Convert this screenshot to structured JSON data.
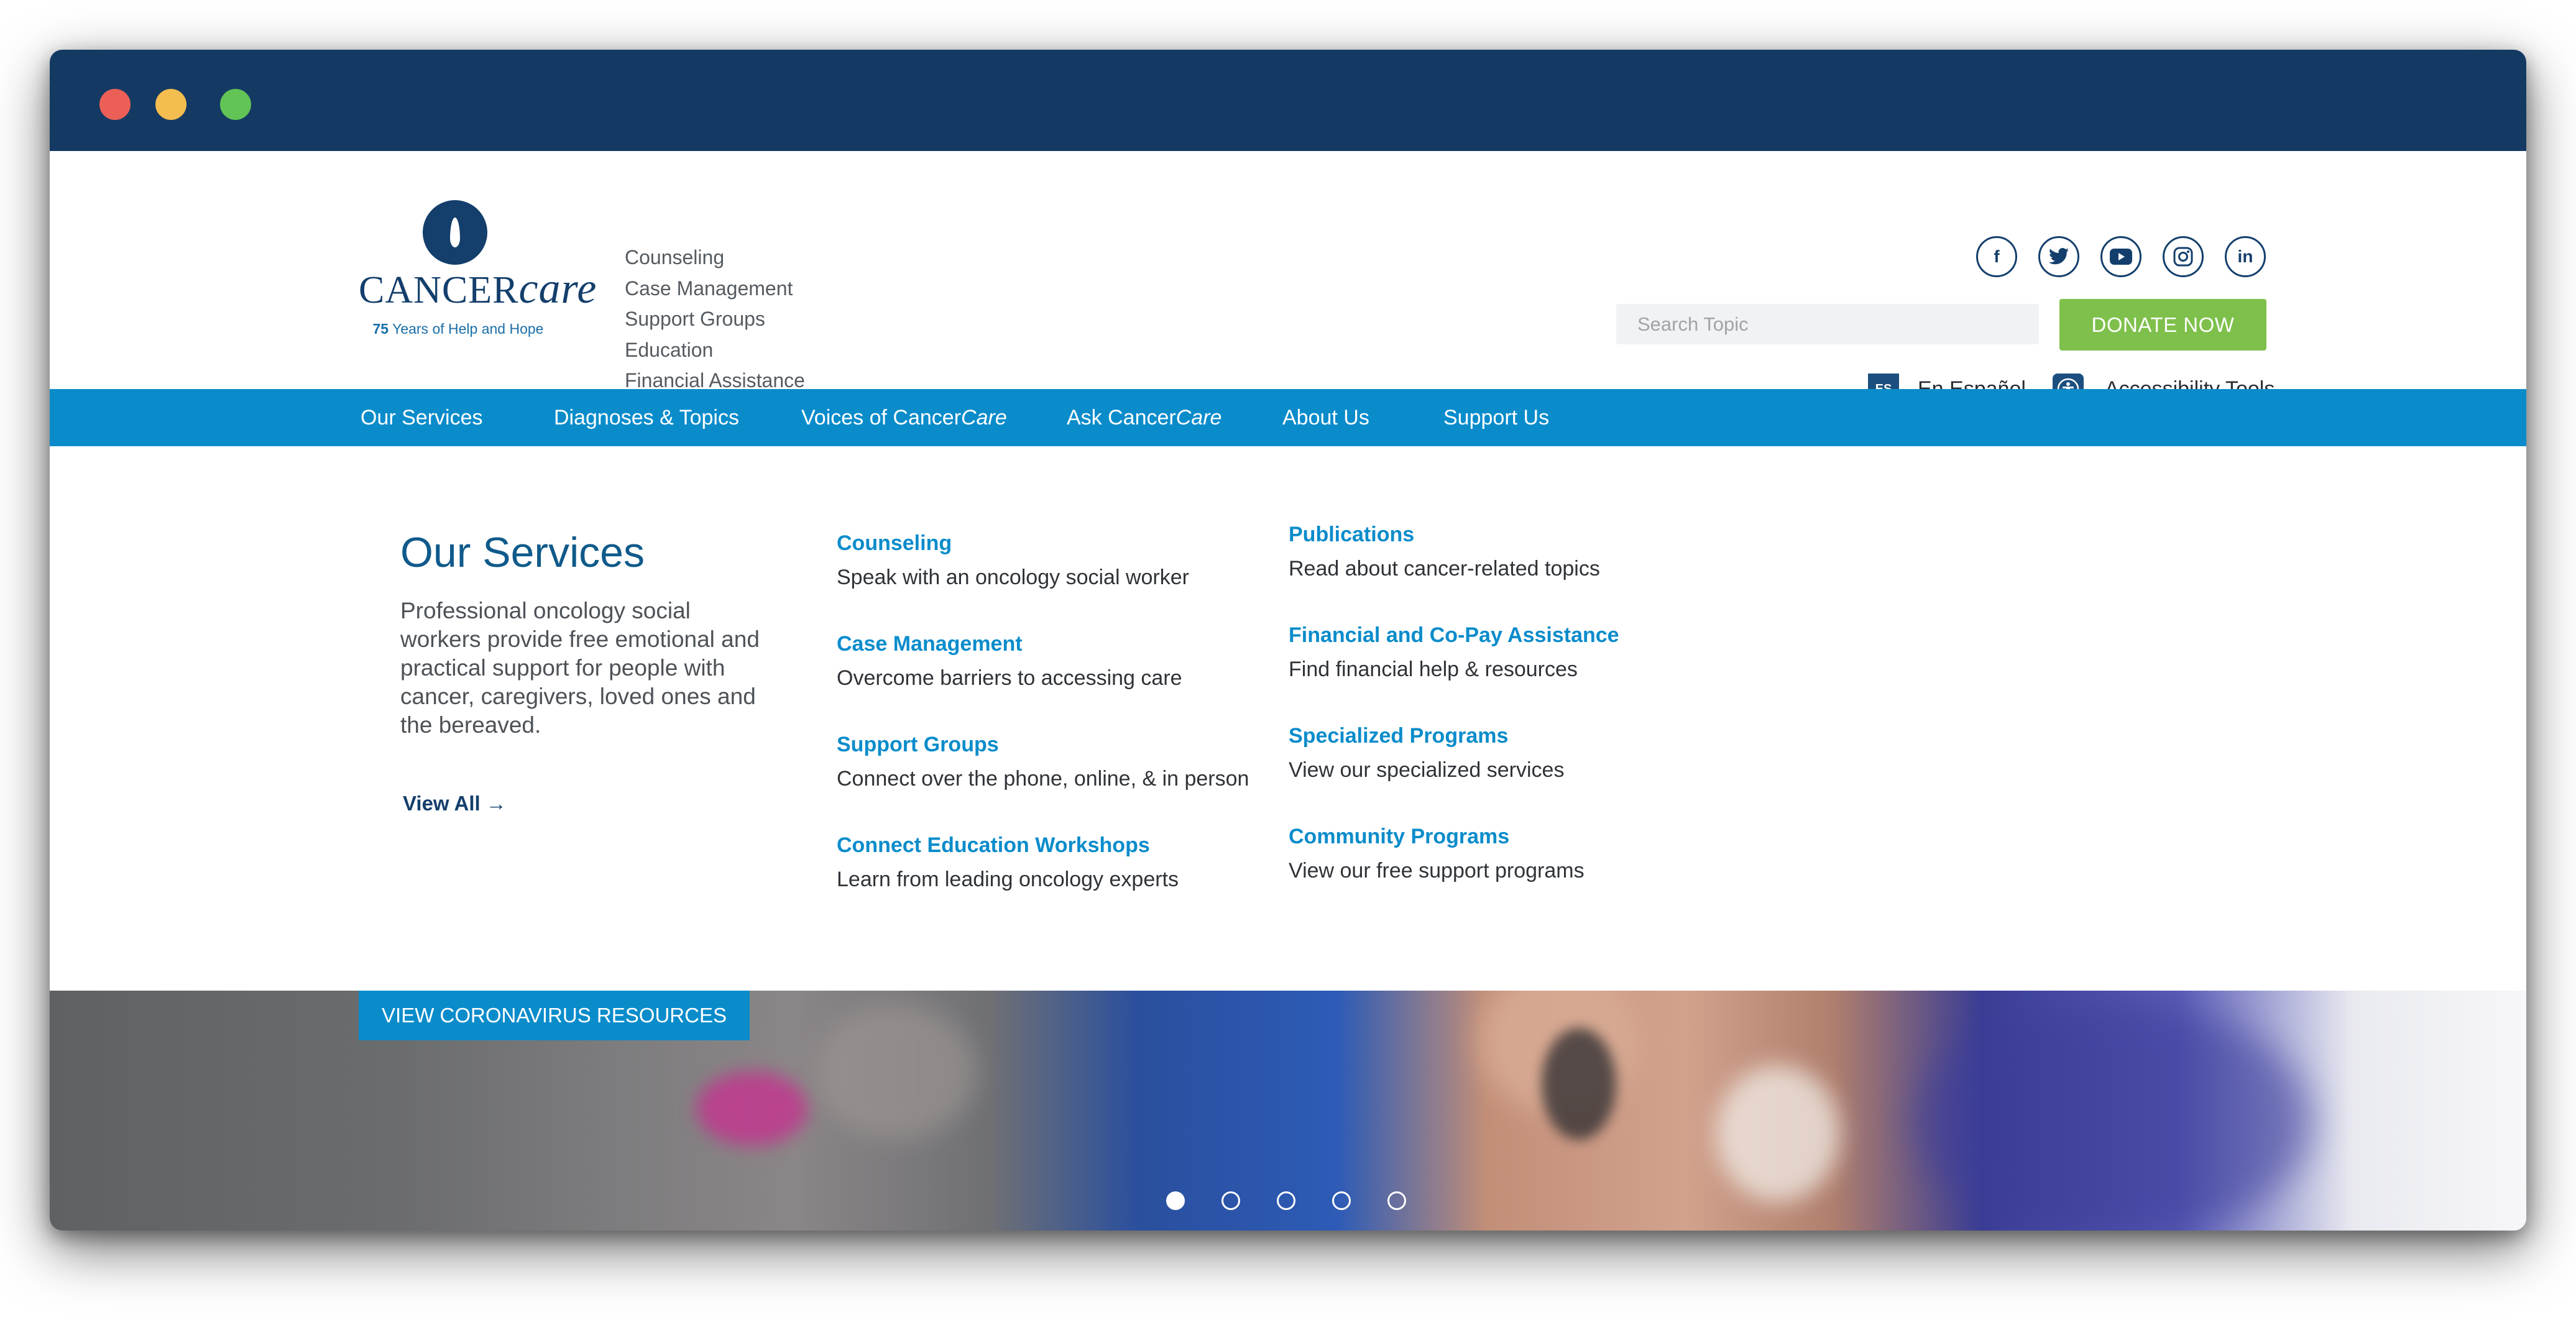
{
  "brand": {
    "name_part1": "CANCER",
    "name_part2": "care",
    "tagline_bold": "75",
    "tagline_rest": " Years of Help and Hope"
  },
  "quick_links": [
    "Counseling",
    "Case Management",
    "Support Groups",
    "Education",
    "Financial Assistance"
  ],
  "socials": [
    {
      "icon": "facebook-icon",
      "glyph": "f"
    },
    {
      "icon": "twitter-icon",
      "glyph": "t"
    },
    {
      "icon": "youtube-icon",
      "glyph": "▶"
    },
    {
      "icon": "instagram-icon",
      "glyph": "◎"
    },
    {
      "icon": "linkedin-icon",
      "glyph": "in"
    }
  ],
  "search": {
    "placeholder": "Search Topic"
  },
  "donate_label": "DONATE NOW",
  "language": {
    "badge": "ES",
    "label": "En Español"
  },
  "accessibility_label": "Accessibility Tools",
  "nav": {
    "our_services": "Our Services",
    "diagnoses": "Diagnoses & Topics",
    "voices_prefix": "Voices of Cancer",
    "voices_italic": "Care",
    "ask_prefix": "Ask Cancer",
    "ask_italic": "Care",
    "about": "About Us",
    "support": "Support Us"
  },
  "menu": {
    "title": "Our Services",
    "description": "Professional oncology social workers provide free emotional and practical support for people with cancer, caregivers, loved ones and the bereaved.",
    "view_all": "View All →",
    "left_column": [
      {
        "title": "Counseling",
        "desc": "Speak with an oncology social worker"
      },
      {
        "title": "Case Management",
        "desc": "Overcome barriers to accessing care"
      },
      {
        "title": "Support Groups",
        "desc": "Connect over the phone, online, & in person"
      },
      {
        "title": "Connect Education Workshops",
        "desc": "Learn from leading oncology experts"
      }
    ],
    "right_column": [
      {
        "title": "Publications",
        "desc": "Read about cancer-related topics"
      },
      {
        "title": "Financial and Co-Pay Assistance",
        "desc": "Find financial help & resources"
      },
      {
        "title": "Specialized Programs",
        "desc": "View our specialized services"
      },
      {
        "title": "Community Programs",
        "desc": "View our free support programs"
      }
    ]
  },
  "hero": {
    "cta_label": "VIEW CORONAVIRUS RESOURCES",
    "slide_count": 5,
    "active_slide": 1
  },
  "colors": {
    "titlebar": "#143a64",
    "nav_bar": "#0a8ccb",
    "donate": "#7ec04b",
    "link": "#0a8ccb",
    "heading": "#0f5a8a"
  }
}
